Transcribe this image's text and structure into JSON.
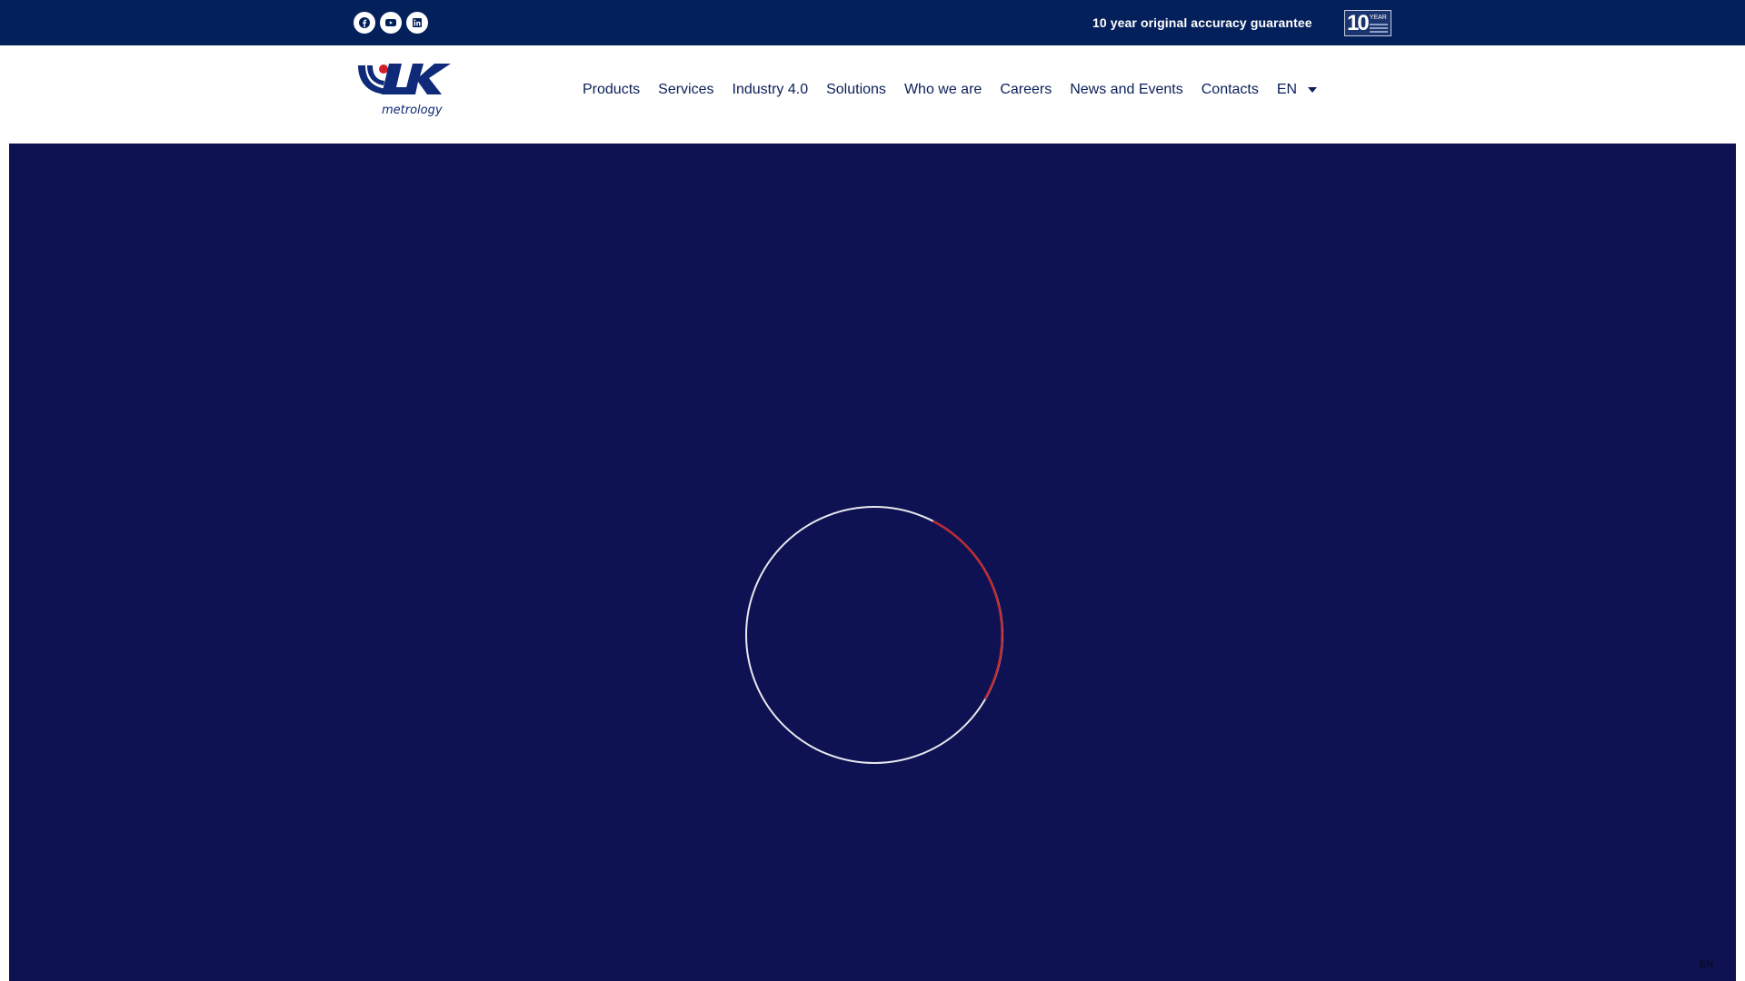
{
  "topbar": {
    "social": [
      {
        "name": "facebook",
        "icon": "facebook-icon"
      },
      {
        "name": "youtube",
        "icon": "youtube-icon"
      },
      {
        "name": "linkedin",
        "icon": "linkedin-icon"
      }
    ],
    "guarantee_text": "10 year original accuracy guarantee",
    "badge": {
      "number": "10",
      "label": "YEAR"
    }
  },
  "header": {
    "logo_text": "metrology",
    "nav": [
      "Products",
      "Services",
      "Industry 4.0",
      "Solutions",
      "Who we are",
      "Careers",
      "News and Events",
      "Contacts"
    ],
    "language": "EN"
  },
  "hero": {
    "loader": {
      "icon": "loading-spinner-icon"
    }
  },
  "corner_language": "EN",
  "colors": {
    "topbar": "#04205a",
    "hero": "#0e1253",
    "nav_text": "#0b1f58",
    "accent_red": "#c0282d"
  }
}
